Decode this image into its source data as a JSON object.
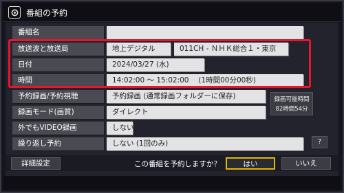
{
  "window": {
    "title": "番組の予約"
  },
  "form": {
    "program_name": {
      "label": "番組名",
      "value": ""
    },
    "channel": {
      "label": "放送波と放送局",
      "wave": "地上デジタル",
      "station": "011CH - ＮＨＫ総合１・東京"
    },
    "date": {
      "label": "日付",
      "value": "2024/03/27 (水)"
    },
    "time": {
      "label": "時間",
      "value": "14:02:00 〜 15:02:00　 (1時間00分00秒)"
    },
    "rec_type": {
      "label": "予約録画/予約視聴",
      "value": "予約録画 (通常録画フォルダーに保存)"
    },
    "rec_mode": {
      "label": "録画モード(画質)",
      "value": "ダイレクト"
    },
    "outside": {
      "label": "外でもVIDEO録画",
      "value": "しない"
    },
    "repeat": {
      "label": "繰り返し予約",
      "value": "しない (1回のみ)"
    }
  },
  "side_info": {
    "line1": "録画可能時間",
    "line2": "82時間54分"
  },
  "help_button": "?",
  "footer": {
    "detail_button": "詳細設定",
    "prompt": "この番組を予約しますか？",
    "yes_button": "はい",
    "no_button": "いいえ"
  },
  "colors": {
    "highlight": "#e8152c",
    "focus": "#e0b800"
  }
}
